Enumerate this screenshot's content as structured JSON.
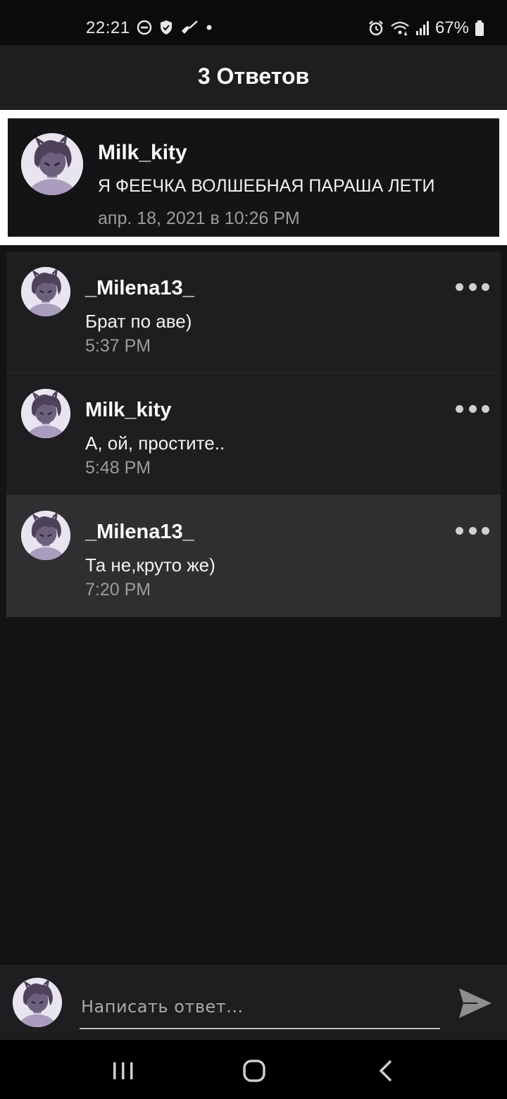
{
  "status_bar": {
    "time": "22:21",
    "battery": "67%",
    "left_icons": [
      "do-not-disturb-icon",
      "shield-icon",
      "broom-icon",
      "dot-icon"
    ],
    "right_icons": [
      "alarm-icon",
      "wifi-icon",
      "signal-icon",
      "battery-icon"
    ]
  },
  "header": {
    "title": "3 Ответов"
  },
  "parent_comment": {
    "author": "Milk_kity",
    "text": "Я ФЕЕЧКА ВОЛШЕБНАЯ ПАРАША ЛЕТИ",
    "timestamp": "апр. 18, 2021 в 10:26 PM"
  },
  "replies": [
    {
      "author": "_Milena13_",
      "text": "Брат по аве)",
      "time": "5:37 PM",
      "highlighted": false
    },
    {
      "author": "Milk_kity",
      "text": "А, ой, простите..",
      "time": "5:48 PM",
      "highlighted": false
    },
    {
      "author": "_Milena13_",
      "text": "Та не,круто же)",
      "time": "7:20 PM",
      "highlighted": true
    }
  ],
  "composer": {
    "placeholder": "Написать ответ...",
    "value": ""
  },
  "nav": [
    "recents-icon",
    "home-icon",
    "back-icon"
  ],
  "colors": {
    "background": "#141316",
    "card": "#1e1d20",
    "highlight": "#2f2e31",
    "secondary_text": "#9c9c9f",
    "avatar_hair": "#5b4f6b",
    "avatar_body": "#a99cbd"
  }
}
